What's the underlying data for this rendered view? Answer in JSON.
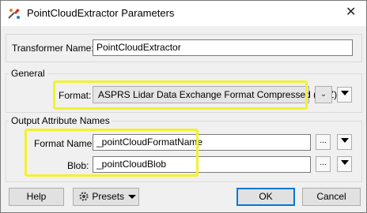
{
  "window": {
    "title": "PointCloudExtractor Parameters",
    "close_glyph": "✕",
    "icon": "fme-transformer-icon"
  },
  "transformer": {
    "label": "Transformer Name:",
    "value": "PointCloudExtractor"
  },
  "general": {
    "legend": "General",
    "format_label": "Format:",
    "format_value": "ASPRS Lidar Data Exchange Format Compressed (LAZ)"
  },
  "output": {
    "legend": "Output Attribute Names",
    "format_name_label": "Format Name:",
    "format_name_value": "_pointCloudFormatName",
    "blob_label": "Blob:",
    "blob_value": "_pointCloudBlob"
  },
  "buttons": {
    "ellipsis": "...",
    "help": "Help",
    "presets": "Presets",
    "ok": "OK",
    "cancel": "Cancel"
  },
  "colors": {
    "highlight": "#f2f22e",
    "default_button_border": "#0078d7"
  }
}
